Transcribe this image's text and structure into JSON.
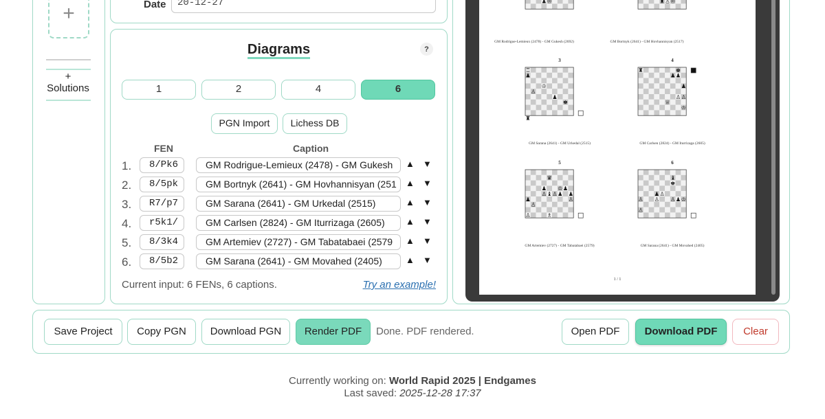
{
  "sidebar": {
    "add_label": "+",
    "solutions_label": "+ Solutions"
  },
  "date": {
    "label": "Date",
    "value": "20-12-27"
  },
  "diagrams": {
    "title": "Diagrams",
    "help": "?",
    "counts": [
      "1",
      "2",
      "4",
      "6"
    ],
    "active_count": "6",
    "import_buttons": [
      "PGN Import",
      "Lichess DB"
    ],
    "col_fen": "FEN",
    "col_caption": "Caption",
    "up_arrow": "▲",
    "down_arrow": "▼",
    "rows": [
      {
        "num": "1.",
        "fen": "8/Pk6",
        "caption": "GM Rodrigue-Lemieux (2478) - GM Gukesh"
      },
      {
        "num": "2.",
        "fen": "8/5pk",
        "caption": "GM Bortnyk (2641) - GM Hovhannisyan (251"
      },
      {
        "num": "3.",
        "fen": "R7/p7",
        "caption": "GM Sarana (2641) - GM Urkedal (2515)"
      },
      {
        "num": "4.",
        "fen": "r5k1/",
        "caption": "GM Carlsen (2824) - GM Iturrizaga (2605)"
      },
      {
        "num": "5.",
        "fen": "8/3k4",
        "caption": "GM Artemiev (2727) - GM Tabatabaei (2579"
      },
      {
        "num": "6.",
        "fen": "8/5b2",
        "caption": "GM Sarana (2641) - GM Movahed (2405)"
      }
    ],
    "status": "Current input: 6 FENs, 6 captions.",
    "example_link": "Try an example!"
  },
  "preview": {
    "captions_top": [
      "GM Rodrigue-Lemieux (2478) - GM Gukesh (2692)",
      "GM Bortnyk (2641) - GM Hovhannisyan (2517)"
    ],
    "diagrams": [
      {
        "num": "3",
        "caption": "GM Sarana (2641) - GM Urkedal (2515)"
      },
      {
        "num": "4",
        "caption": "GM Carlsen (2824) - GM Iturrizaga (2605)"
      },
      {
        "num": "5",
        "caption": "GM Artemiev (2727) - GM Tabatabaei (2579)"
      },
      {
        "num": "6",
        "caption": "GM Sarana (2641) - GM Movahed (2405)"
      }
    ],
    "page_indicator": "1 / 1"
  },
  "actions": {
    "save_project": "Save Project",
    "copy_pgn": "Copy PGN",
    "download_pgn": "Download PGN",
    "render_pdf": "Render PDF",
    "status": "Done. PDF rendered.",
    "open_pdf": "Open PDF",
    "download_pdf": "Download PDF",
    "clear": "Clear"
  },
  "footer": {
    "working_prefix": "Currently working on:",
    "project_name": "World Rapid 2025 | Endgames",
    "saved_prefix": "Last saved:",
    "saved_time": "2025-12-28 17:37"
  },
  "colors": {
    "accent": "#6fd9b7",
    "panel_border": "#9fd9c6",
    "clear_text": "#c0392b",
    "link": "#2a6fb0"
  }
}
